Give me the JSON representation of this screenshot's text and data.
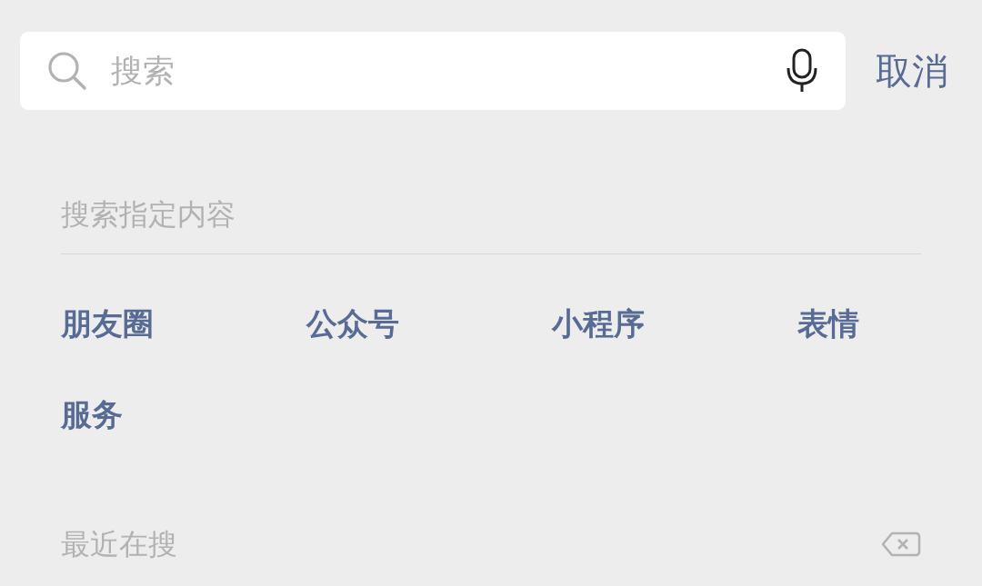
{
  "search": {
    "placeholder": "搜索",
    "cancel": "取消"
  },
  "section_title": "搜索指定内容",
  "categories": [
    "朋友圈",
    "公众号",
    "小程序",
    "表情",
    "服务"
  ],
  "recent": {
    "title": "最近在搜"
  }
}
